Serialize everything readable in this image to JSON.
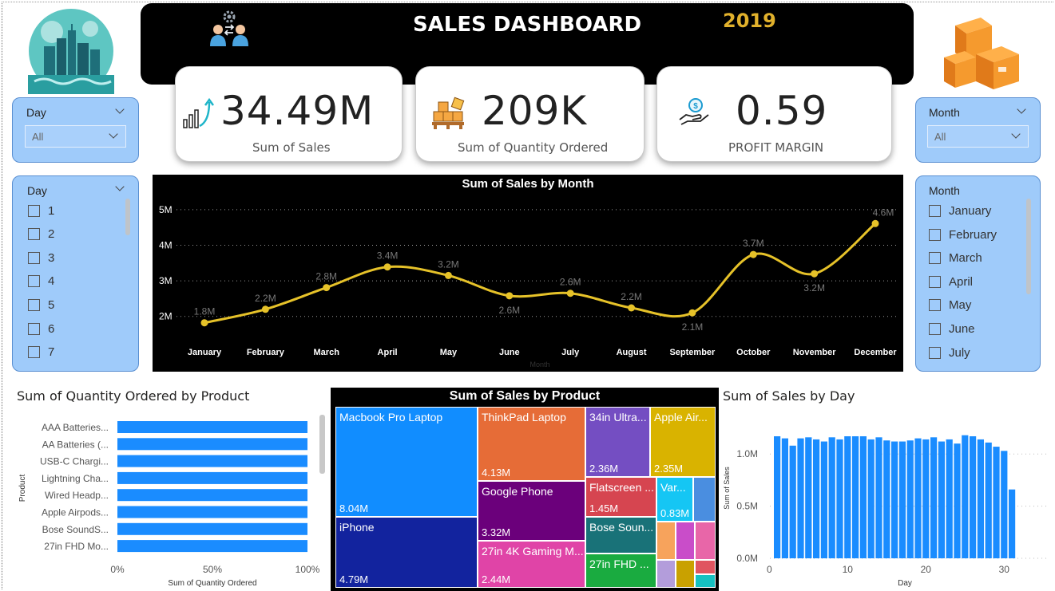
{
  "header": {
    "title": "SALES DASHBOARD",
    "year": "2019"
  },
  "kpis": [
    {
      "value": "34.49M",
      "label": "Sum of Sales",
      "icon": "growth-chart-icon"
    },
    {
      "value": "209K",
      "label": "Sum of Quantity Ordered",
      "icon": "boxes-pallet-icon"
    },
    {
      "value": "0.59",
      "label": "PROFIT MARGIN",
      "icon": "hand-money-icon"
    }
  ],
  "slicers": {
    "day_dropdown": {
      "title": "Day",
      "value": "All"
    },
    "month_dropdown": {
      "title": "Month",
      "value": "All"
    },
    "day_list": {
      "title": "Day",
      "items": [
        "1",
        "2",
        "3",
        "4",
        "5",
        "6",
        "7"
      ]
    },
    "month_list": {
      "title": "Month",
      "items": [
        "January",
        "February",
        "March",
        "April",
        "May",
        "June",
        "July"
      ]
    }
  },
  "line_chart": {
    "title": "Sum of Sales by Month",
    "xlabel": "Month",
    "y_ticks": [
      "5M",
      "4M",
      "3M",
      "2M"
    ],
    "chart_data": {
      "type": "line",
      "categories": [
        "January",
        "February",
        "March",
        "April",
        "May",
        "June",
        "July",
        "August",
        "September",
        "October",
        "November",
        "December"
      ],
      "values": [
        1.82,
        2.2,
        2.81,
        3.39,
        3.15,
        2.58,
        2.65,
        2.24,
        2.1,
        3.74,
        3.2,
        4.61
      ],
      "data_labels": [
        "1.8M",
        "2.2M",
        "2.8M",
        "3.4M",
        "3.2M",
        "2.6M",
        "2.6M",
        "2.2M",
        "2.1M",
        "3.7M",
        "3.2M",
        "4.6M"
      ],
      "ylim": [
        1.5,
        5.2
      ],
      "color": "#e6c229"
    }
  },
  "bar_chart": {
    "title": "Sum of Quantity Ordered by Product",
    "ylabel": "Product",
    "xlabel": "Sum of Quantity Ordered",
    "x_ticks": [
      "0%",
      "50%",
      "100%"
    ],
    "chart_data": {
      "type": "bar",
      "orientation": "horizontal",
      "categories": [
        "AAA Batteries...",
        "AA Batteries (...",
        "USB-C Chargi...",
        "Lightning Cha...",
        "Wired Headp...",
        "Apple Airpods...",
        "Bose SoundS...",
        "27in FHD Mo..."
      ],
      "values": [
        100,
        100,
        100,
        100,
        100,
        100,
        100,
        100
      ],
      "xlim": [
        0,
        100
      ],
      "color": "#1a8cff"
    }
  },
  "treemap": {
    "title": "Sum of Sales by Product",
    "chart_data": {
      "type": "treemap",
      "items": [
        {
          "name": "Macbook Pro Laptop",
          "value": "8.04M",
          "color": "#118dff"
        },
        {
          "name": "iPhone",
          "value": "4.79M",
          "color": "#12239e"
        },
        {
          "name": "ThinkPad Laptop",
          "value": "4.13M",
          "color": "#e66c37"
        },
        {
          "name": "Google Phone",
          "value": "3.32M",
          "color": "#6b007b"
        },
        {
          "name": "27in 4K Gaming M...",
          "value": "2.44M",
          "color": "#e044a7"
        },
        {
          "name": "34in Ultra...",
          "value": "2.36M",
          "color": "#744ec2"
        },
        {
          "name": "Apple Air...",
          "value": "2.35M",
          "color": "#d9b300"
        },
        {
          "name": "Flatscreen ...",
          "value": "1.45M",
          "color": "#d64550"
        },
        {
          "name": "Var...",
          "value": "0.83M",
          "color": "#15c6f4"
        },
        {
          "name": "Bose Soun...",
          "value": "",
          "color": "#197278"
        },
        {
          "name": "27in FHD ...",
          "value": "",
          "color": "#1aab40"
        }
      ]
    }
  },
  "day_chart": {
    "title": "Sum of Sales by Day",
    "xlabel": "Day",
    "ylabel": "Sum of Sales",
    "y_ticks": [
      "1.0M",
      "0.5M",
      "0.0M"
    ],
    "x_ticks": [
      "0",
      "10",
      "20",
      "30"
    ],
    "chart_data": {
      "type": "bar",
      "categories": [
        1,
        2,
        3,
        4,
        5,
        6,
        7,
        8,
        9,
        10,
        11,
        12,
        13,
        14,
        15,
        16,
        17,
        18,
        19,
        20,
        21,
        22,
        23,
        24,
        25,
        26,
        27,
        28,
        29,
        30,
        31
      ],
      "values": [
        1.17,
        1.15,
        1.08,
        1.15,
        1.16,
        1.14,
        1.12,
        1.16,
        1.14,
        1.17,
        1.17,
        1.17,
        1.14,
        1.16,
        1.13,
        1.12,
        1.12,
        1.13,
        1.15,
        1.14,
        1.16,
        1.12,
        1.14,
        1.1,
        1.18,
        1.17,
        1.14,
        1.11,
        1.07,
        1.03,
        0.66
      ],
      "ylim": [
        0,
        1.3
      ],
      "color": "#1a8cff"
    }
  }
}
